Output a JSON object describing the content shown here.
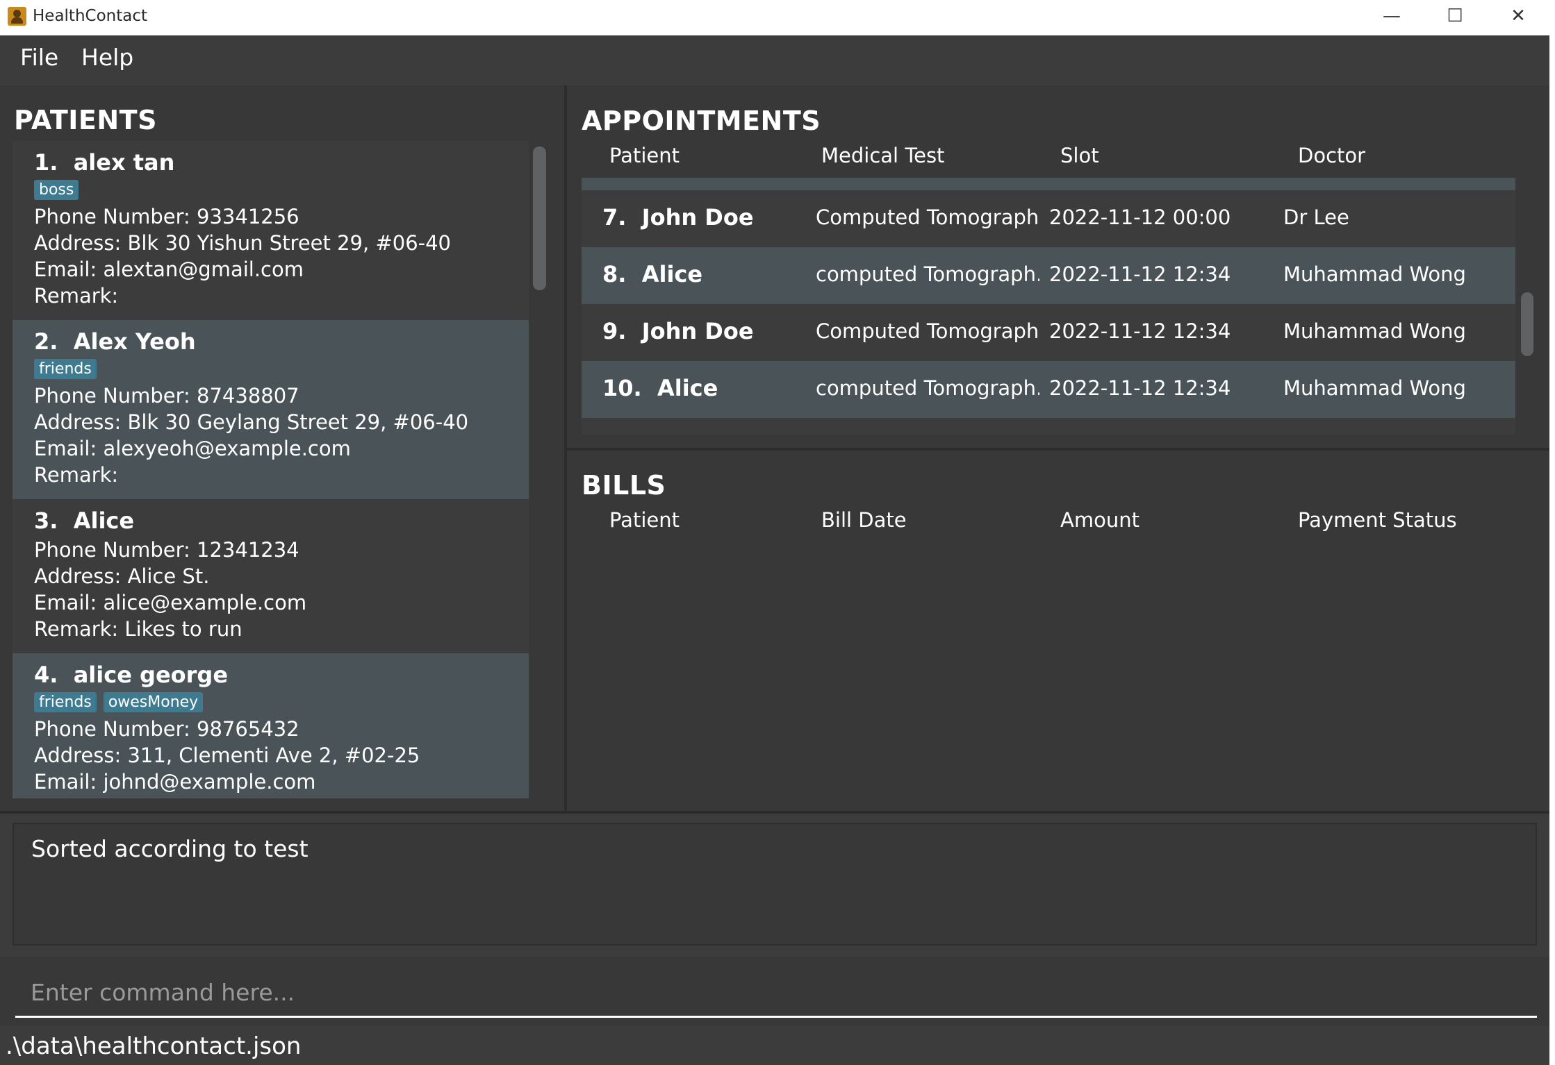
{
  "window": {
    "title": "HealthContact",
    "minimize": "—",
    "maximize": "☐",
    "close": "✕"
  },
  "menu": [
    "File",
    "Help"
  ],
  "patients": {
    "title": "PATIENTS",
    "items": [
      {
        "index": "1.",
        "name": "alex tan",
        "tags": [
          "boss"
        ],
        "phone": "Phone Number: 93341256",
        "address": "Address: Blk 30 Yishun Street 29, #06-40",
        "email": "Email: alextan@gmail.com",
        "remark": "Remark:"
      },
      {
        "index": "2.",
        "name": "Alex Yeoh",
        "tags": [
          "friends"
        ],
        "phone": "Phone Number: 87438807",
        "address": "Address: Blk 30 Geylang Street 29, #06-40",
        "email": "Email: alexyeoh@example.com",
        "remark": "Remark:"
      },
      {
        "index": "3.",
        "name": "Alice",
        "tags": [],
        "phone": "Phone Number: 12341234",
        "address": "Address: Alice St.",
        "email": "Email: alice@example.com",
        "remark": "Remark: Likes to run"
      },
      {
        "index": "4.",
        "name": "alice george",
        "tags": [
          "friends",
          "owesMoney"
        ],
        "phone": "Phone Number: 98765432",
        "address": "Address: 311, Clementi Ave 2, #02-25",
        "email": "Email: johnd@example.com",
        "remark": ""
      }
    ]
  },
  "appointments": {
    "title": "APPOINTMENTS",
    "columns": [
      "Patient",
      "Medical Test",
      "Slot",
      "Doctor"
    ],
    "rows": [
      {
        "index": "7.",
        "patient": "John Doe",
        "test": "Computed Tomography",
        "slot": "2022-11-12 00:00",
        "doctor": "Dr Lee"
      },
      {
        "index": "8.",
        "patient": "Alice",
        "test": "computed Tomograph...",
        "slot": "2022-11-12 12:34",
        "doctor": "Muhammad Wong"
      },
      {
        "index": "9.",
        "patient": "John Doe",
        "test": "Computed Tomograph...",
        "slot": "2022-11-12 12:34",
        "doctor": "Muhammad Wong"
      },
      {
        "index": "10.",
        "patient": "Alice",
        "test": "computed Tomograph...",
        "slot": "2022-11-12 12:34",
        "doctor": "Muhammad Wong"
      }
    ]
  },
  "bills": {
    "title": "BILLS",
    "columns": [
      "Patient",
      "Bill Date",
      "Amount",
      "Payment Status"
    ]
  },
  "result": {
    "text": "Sorted according to test"
  },
  "command": {
    "placeholder": "Enter command here..."
  },
  "status": {
    "path": ".\\data\\healthcontact.json"
  },
  "icons": {
    "app": "address-book-icon"
  },
  "colors": {
    "background": "#3c3c3c",
    "panel": "#383838",
    "selected_row": "#4a5458",
    "tag": "#3e7b91"
  }
}
